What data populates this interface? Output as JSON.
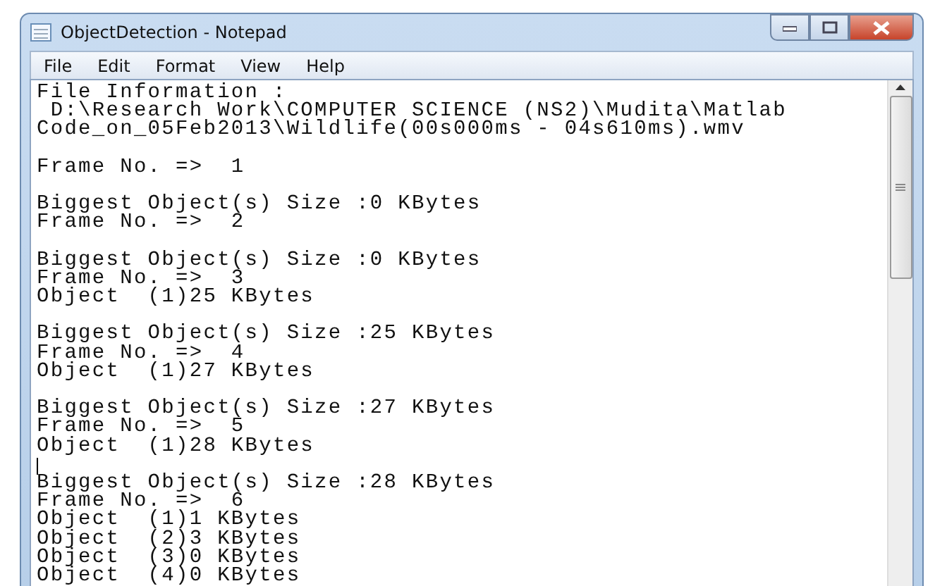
{
  "window": {
    "title": "ObjectDetection - Notepad"
  },
  "menu": [
    "File",
    "Edit",
    "Format",
    "View",
    "Help"
  ],
  "text_area": {
    "blocks": [
      {
        "caret": false,
        "lines": [
          "File Information :",
          " D:\\Research Work\\COMPUTER SCIENCE (NS2)\\Mudita\\Matlab",
          "Code_on_05Feb2013\\Wildlife(00s000ms - 04s610ms).wmv"
        ]
      },
      {
        "caret": false,
        "lines": [
          "Frame No. =>  1"
        ]
      },
      {
        "caret": false,
        "lines": [
          "Biggest Object(s) Size :0 KBytes",
          "Frame No. =>  2"
        ]
      },
      {
        "caret": false,
        "lines": [
          "Biggest Object(s) Size :0 KBytes",
          "Frame No. =>  3",
          "Object  (1)25 KBytes"
        ]
      },
      {
        "caret": false,
        "lines": [
          "Biggest Object(s) Size :25 KBytes",
          "Frame No. =>  4",
          "Object  (1)27 KBytes"
        ]
      },
      {
        "caret": false,
        "lines": [
          "Biggest Object(s) Size :27 KBytes",
          "Frame No. =>  5",
          "Object  (1)28 KBytes"
        ]
      },
      {
        "caret": true,
        "lines": [
          "Biggest Object(s) Size :28 KBytes",
          "Frame No. =>  6",
          "Object  (1)1 KBytes",
          "Object  (2)3 KBytes",
          "Object  (3)0 KBytes",
          "Object  (4)0 KBytes"
        ]
      }
    ]
  }
}
